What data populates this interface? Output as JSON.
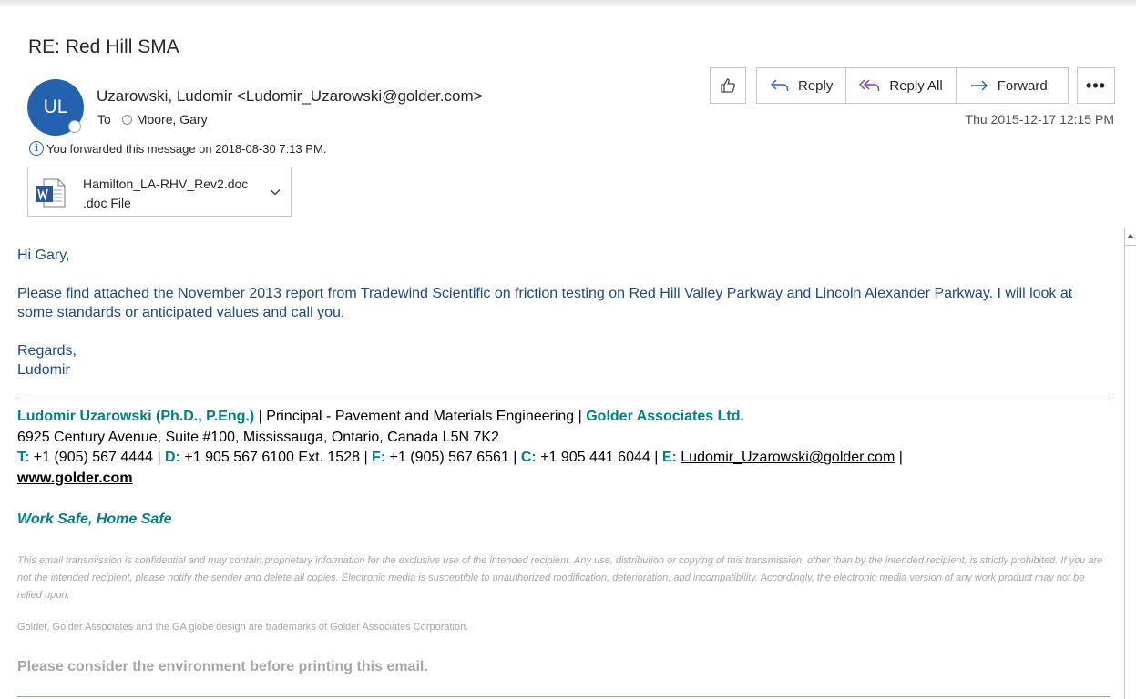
{
  "subject": "RE: Red Hill SMA",
  "sender": {
    "initials": "UL",
    "display": "Uzarowski, Ludomir <Ludomir_Uzarowski@golder.com>",
    "to_label": "To",
    "recipient": "Moore, Gary",
    "datetime": "Thu 2015-12-17 12:15 PM"
  },
  "toolbar": {
    "reply_label": "Reply",
    "reply_all_label": "Reply All",
    "forward_label": "Forward",
    "more_label": "•••",
    "like_icon": "thumbs-up-icon"
  },
  "forward_note": "You forwarded this message on 2018-08-30 7:13 PM.",
  "attachment": {
    "name": "Hamilton_LA-RHV_Rev2.doc",
    "type": ".doc File",
    "icon": "word-doc-icon"
  },
  "body": {
    "greeting": "Hi Gary,",
    "paragraph": "Please find attached the November 2013 report from Tradewind Scientific on friction testing on Red Hill Valley Parkway and Lincoln Alexander Parkway. I will look at some standards or anticipated values and call you.",
    "closing": "Regards,",
    "name": "Ludomir"
  },
  "signature": {
    "name": "Ludomir Uzarowski (Ph.D., P.Eng.)",
    "title": " | Principal - Pavement and Materials Engineering | ",
    "company": "Golder Associates Ltd.",
    "address": "6925 Century Avenue, Suite #100, Mississauga, Ontario, Canada L5N 7K2",
    "t_label": "T:",
    "t_value": " +1 (905) 567 4444 | ",
    "d_label": "D:",
    "d_value": " +1 905 567 6100 Ext. 1528 | ",
    "f_label": "F:",
    "f_value": " +1 (905) 567 6561 | ",
    "c_label": "C:",
    "c_value": " +1 905 441 6044 | ",
    "e_label": "E:",
    "e_value": "Ludomir_Uzarowski@golder.com",
    "sep": " |",
    "website": "www.golder.com",
    "motto": "Work Safe, Home Safe"
  },
  "disclaimer": "This email transmission is confidential and may contain proprietary information for the exclusive use of the intended recipient. Any use, distribution or copying of this transmission, other than by the intended recipient, is strictly prohibited. If you are not the intended recipient, please notify the sender and delete all copies. Electronic media is susceptible to unauthorized modification, deterioration, and incompatibility. Accordingly, the electronic media version of any work product may not be relied upon.",
  "trademark": "Golder, Golder Associates and the GA globe design are trademarks of Golder Associates Corporation.",
  "environment": "Please consider the environment before printing this email.",
  "colors": {
    "avatar": "#2462b0",
    "body_text": "#1f497d",
    "signature_teal": "#008080",
    "disclaimer_gray": "#a6a6a6"
  }
}
